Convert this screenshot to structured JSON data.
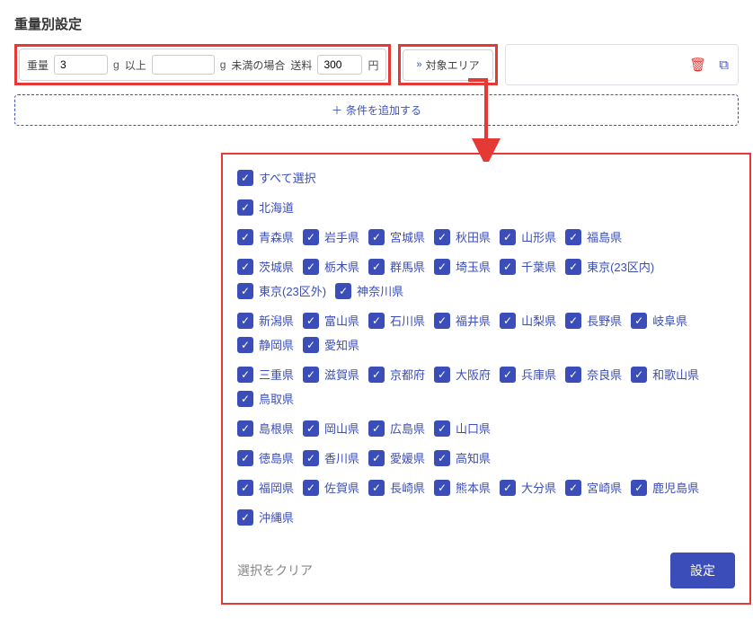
{
  "section_title": "重量別設定",
  "condition": {
    "weight_label": "重量",
    "min_value": "3",
    "unit_g_1": "g",
    "ijou": "以上",
    "max_value": "",
    "unit_g_2": "g",
    "miman": "未満の場合",
    "souryou": "送料",
    "fee_value": "300",
    "yen": "円"
  },
  "target_area_label": "対象エリア",
  "add_condition_label": "条件を追加する",
  "panel": {
    "select_all_label": "すべて選択",
    "groups": [
      {
        "items": [
          "北海道"
        ]
      },
      {
        "items": [
          "青森県",
          "岩手県",
          "宮城県",
          "秋田県",
          "山形県",
          "福島県"
        ]
      },
      {
        "items": [
          "茨城県",
          "栃木県",
          "群馬県",
          "埼玉県",
          "千葉県",
          "東京(23区内)",
          "東京(23区外)",
          "神奈川県"
        ]
      },
      {
        "items": [
          "新潟県",
          "富山県",
          "石川県",
          "福井県",
          "山梨県",
          "長野県",
          "岐阜県",
          "静岡県",
          "愛知県"
        ]
      },
      {
        "items": [
          "三重県",
          "滋賀県",
          "京都府",
          "大阪府",
          "兵庫県",
          "奈良県",
          "和歌山県",
          "鳥取県"
        ]
      },
      {
        "items": [
          "島根県",
          "岡山県",
          "広島県",
          "山口県"
        ]
      },
      {
        "items": [
          "徳島県",
          "香川県",
          "愛媛県",
          "高知県"
        ]
      },
      {
        "items": [
          "福岡県",
          "佐賀県",
          "長崎県",
          "熊本県",
          "大分県",
          "宮崎県",
          "鹿児島県"
        ]
      },
      {
        "items": [
          "沖縄県"
        ]
      }
    ],
    "clear_label": "選択をクリア",
    "submit_label": "設定"
  }
}
